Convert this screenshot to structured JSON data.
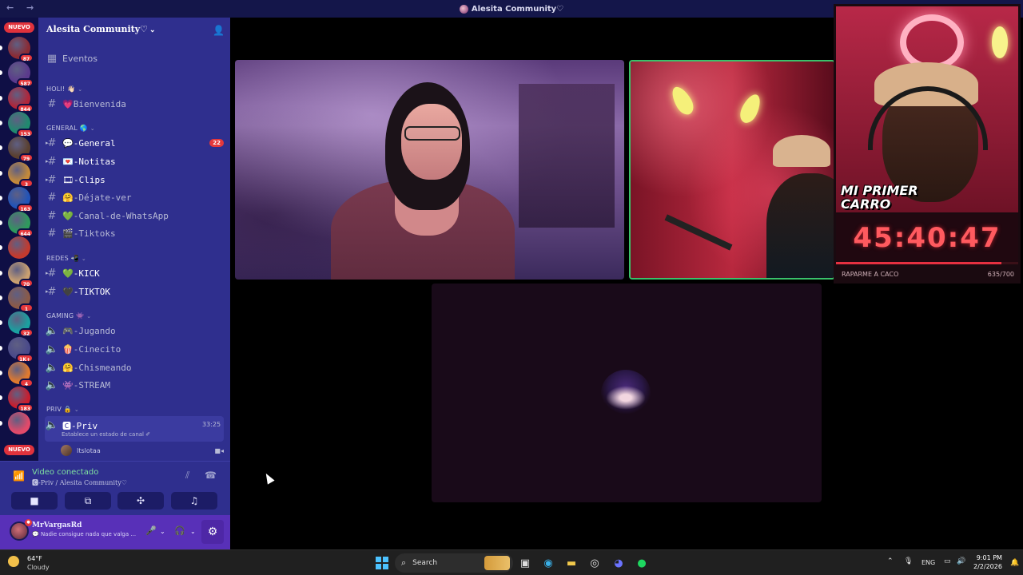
{
  "window": {
    "title": "Alesita Community♡",
    "nav_glyphs": "← →"
  },
  "servers": {
    "new_badge_top": "NUEVO",
    "new_badge_bottom": "NUEVO",
    "items": [
      {
        "badge": "87",
        "color": "#8a2b34"
      },
      {
        "badge": "587",
        "color": "#5b3a8c"
      },
      {
        "badge": "844",
        "color": "#b0263a"
      },
      {
        "badge": "153",
        "color": "#1f8a6e"
      },
      {
        "badge": "79",
        "color": "#5a4030"
      },
      {
        "badge": "3",
        "color": "#c48a3a"
      },
      {
        "badge": "163",
        "color": "#2254b8"
      },
      {
        "badge": "644",
        "color": "#2e9a5c"
      },
      {
        "badge": "",
        "color": "#c23a2e"
      },
      {
        "badge": "70",
        "color": "#caa070"
      },
      {
        "badge": "1",
        "color": "#8a5a48"
      },
      {
        "badge": "32",
        "color": "#1aa0a0"
      },
      {
        "badge": "1K+",
        "color": "#4a4a8a"
      },
      {
        "badge": "4",
        "color": "#e07a2e"
      },
      {
        "badge": "183",
        "color": "#c81e2e"
      },
      {
        "badge": "",
        "color": "#e24a6a"
      }
    ]
  },
  "channels": {
    "guild_name": "Alesita Community♡",
    "events_label": "Eventos",
    "categories": {
      "holi": "HOLI! 👋🏻",
      "general": "GENERAL 🌎",
      "redes": "REDES 📲",
      "gaming": "GAMING 👾",
      "priv": "PRIV 🔒"
    },
    "bienvenida": "💗Bienvenida",
    "general": "💬-General",
    "general_count": "22",
    "notitas": "💌-Notitas",
    "clips": "🎞-Clips",
    "dejate": "🤗-Déjate-ver",
    "whatsapp": "💚-Canal-de-WhatsApp",
    "tiktoks": "🎬-Tiktoks",
    "kick": "💚-KICK",
    "tiktok": "🖤-TIKTOK",
    "jugando": "🎮-Jugando",
    "cinecito": "🍿-Cinecito",
    "chismeando": "🤗-Chismeando",
    "stream": "👾-STREAM",
    "priv": "🅲-Priv",
    "priv_timer": "33:25",
    "status_note": "Establece un estado de canal ✐",
    "voice_user": "Itslotaa"
  },
  "voice": {
    "label": "Video conectado",
    "channel": "🅲-Priv / Alesita Community♡"
  },
  "user": {
    "name": "MrVargasRd",
    "status": "💬 Nadie consigue nada que valga ..."
  },
  "stream": {
    "caption_line1": "MI PRIMER",
    "caption_line2": "CARRO",
    "timer": "45:40:47",
    "goal_label": "RAPARME A CACO",
    "goal_value": "635/700",
    "goal_progress": 0.907
  },
  "taskbar": {
    "temp": "64°F",
    "condition": "Cloudy",
    "search_placeholder": "Search",
    "lang": "ENG",
    "time": "9:01 PM",
    "date": "2/2/2026"
  }
}
